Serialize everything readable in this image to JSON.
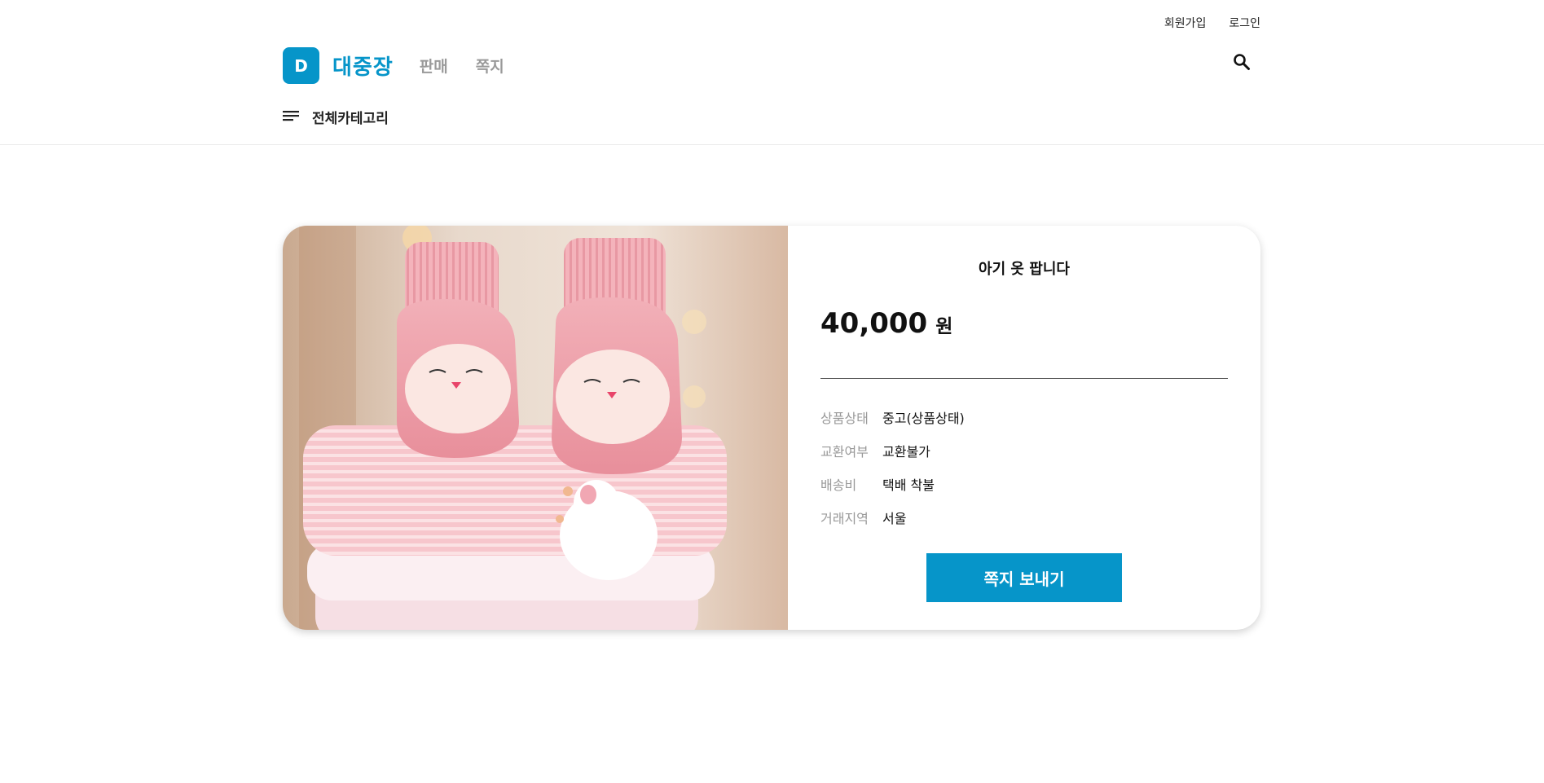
{
  "header": {
    "top_links": {
      "signup": "회원가입",
      "login": "로그인"
    },
    "logo_letter": "D",
    "brand": "대중장",
    "nav": {
      "sell": "판매",
      "messages": "쪽지"
    },
    "category_label": "전체카테고리",
    "icons": {
      "search": "search-icon",
      "menu": "hamburger-menu-icon"
    }
  },
  "product": {
    "title": "아기 옷 팝니다",
    "price": "40,000",
    "currency": "원",
    "details": [
      {
        "label": "상품상태",
        "value": "중고(상품상태)"
      },
      {
        "label": "교환여부",
        "value": "교환불가"
      },
      {
        "label": "배송비",
        "value": "택배 착불"
      },
      {
        "label": "거래지역",
        "value": "서울"
      }
    ],
    "send_message_label": "쪽지 보내기"
  },
  "colors": {
    "brand": "#0695c9",
    "muted_nav": "#9a9a9a",
    "label_gray": "#999999"
  }
}
